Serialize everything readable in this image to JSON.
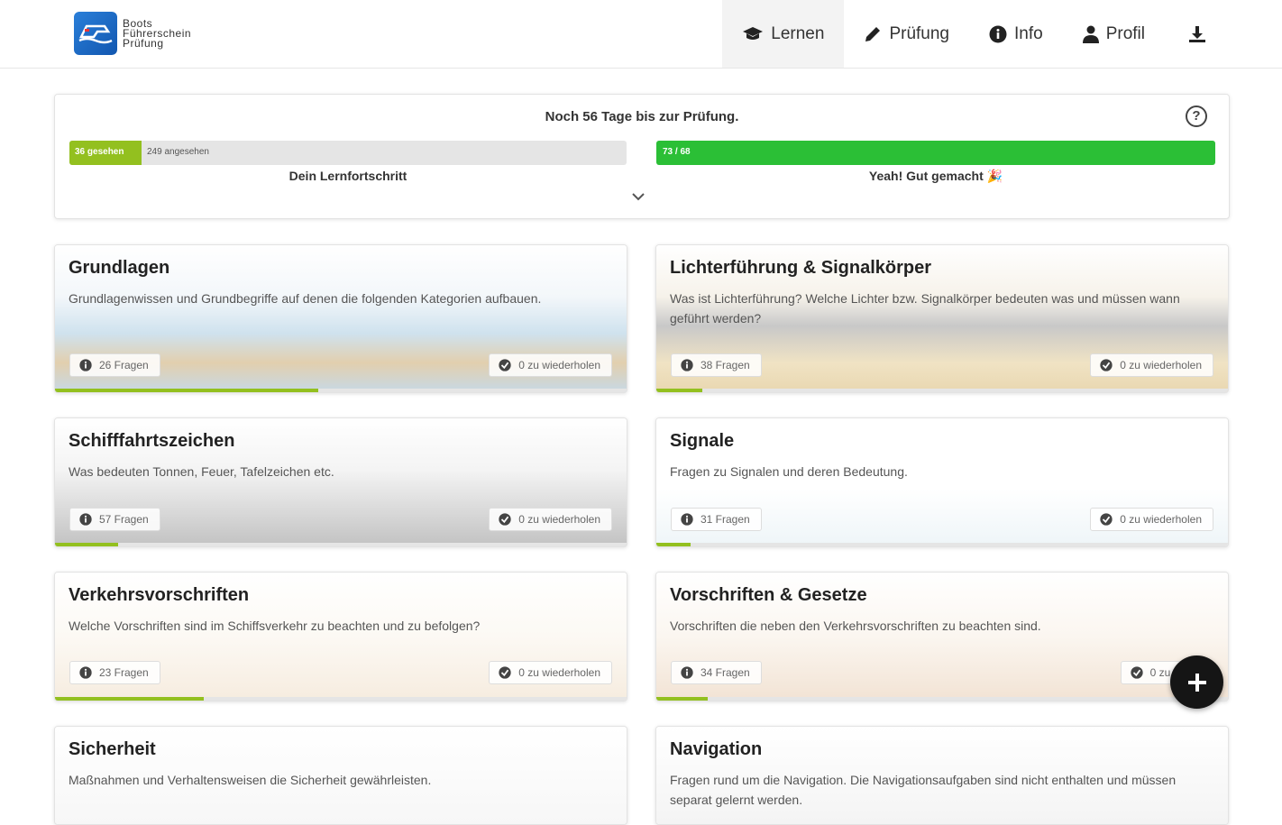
{
  "app": {
    "logo_lines": [
      "Boots",
      "Führerschein",
      "Prüfung"
    ]
  },
  "nav": {
    "items": [
      {
        "label": "Lernen",
        "icon": "graduation-cap-icon",
        "active": true
      },
      {
        "label": "Prüfung",
        "icon": "pencil-icon",
        "active": false
      },
      {
        "label": "Info",
        "icon": "info-circle-icon",
        "active": false
      },
      {
        "label": "Profil",
        "icon": "user-icon",
        "active": false
      }
    ],
    "download_icon": "download-icon"
  },
  "progress": {
    "title": "Noch 56 Tage bis zur Prüfung.",
    "learn_seen_label": "36 gesehen",
    "learn_viewed_label": "249 angesehen",
    "learn_seen_fraction": 0.13,
    "learn_caption": "Dein Lernfortschritt",
    "score_label": "73 / 68",
    "score_fraction": 1.0,
    "score_caption": "Yeah! Gut gemacht 🎉",
    "colors": {
      "learn": "#93c01f",
      "score": "#2bbf36"
    }
  },
  "categories": [
    {
      "title": "Grundlagen",
      "desc": "Grundlagenwissen und Grundbegriffe auf denen die folgenden Kategorien aufbauen.",
      "questions": "26 Fragen",
      "repeat": "0 zu wiederholen",
      "progress": 0.46
    },
    {
      "title": "Lichterführung & Signalkörper",
      "desc": "Was ist Lichterführung? Welche Lichter bzw. Signalkörper bedeuten was und müssen wann geführt werden?",
      "questions": "38 Fragen",
      "repeat": "0 zu wiederholen",
      "progress": 0.08
    },
    {
      "title": "Schifffahrtszeichen",
      "desc": "Was bedeuten Tonnen, Feuer, Tafelzeichen etc.",
      "questions": "57 Fragen",
      "repeat": "0 zu wiederholen",
      "progress": 0.11
    },
    {
      "title": "Signale",
      "desc": "Fragen zu Signalen und deren Bedeutung.",
      "questions": "31 Fragen",
      "repeat": "0 zu wiederholen",
      "progress": 0.06
    },
    {
      "title": "Verkehrsvorschriften",
      "desc": "Welche Vorschriften sind im Schiffsverkehr zu beachten und zu befolgen?",
      "questions": "23 Fragen",
      "repeat": "0 zu wiederholen",
      "progress": 0.26
    },
    {
      "title": "Vorschriften & Gesetze",
      "desc": "Vorschriften die neben den Verkehrsvorschriften zu beachten sind.",
      "questions": "34 Fragen",
      "repeat": "0 zu wiede",
      "progress": 0.09
    },
    {
      "title": "Sicherheit",
      "desc": "Maßnahmen und Verhaltensweisen die Sicherheit gewährleisten.",
      "questions": "",
      "repeat": "",
      "progress": 0
    },
    {
      "title": "Navigation",
      "desc": "Fragen rund um die Navigation. Die Navigationsaufgaben sind nicht enthalten und müssen separat gelernt werden.",
      "questions": "",
      "repeat": "",
      "progress": 0
    }
  ],
  "fab": {
    "icon": "plus-icon"
  }
}
